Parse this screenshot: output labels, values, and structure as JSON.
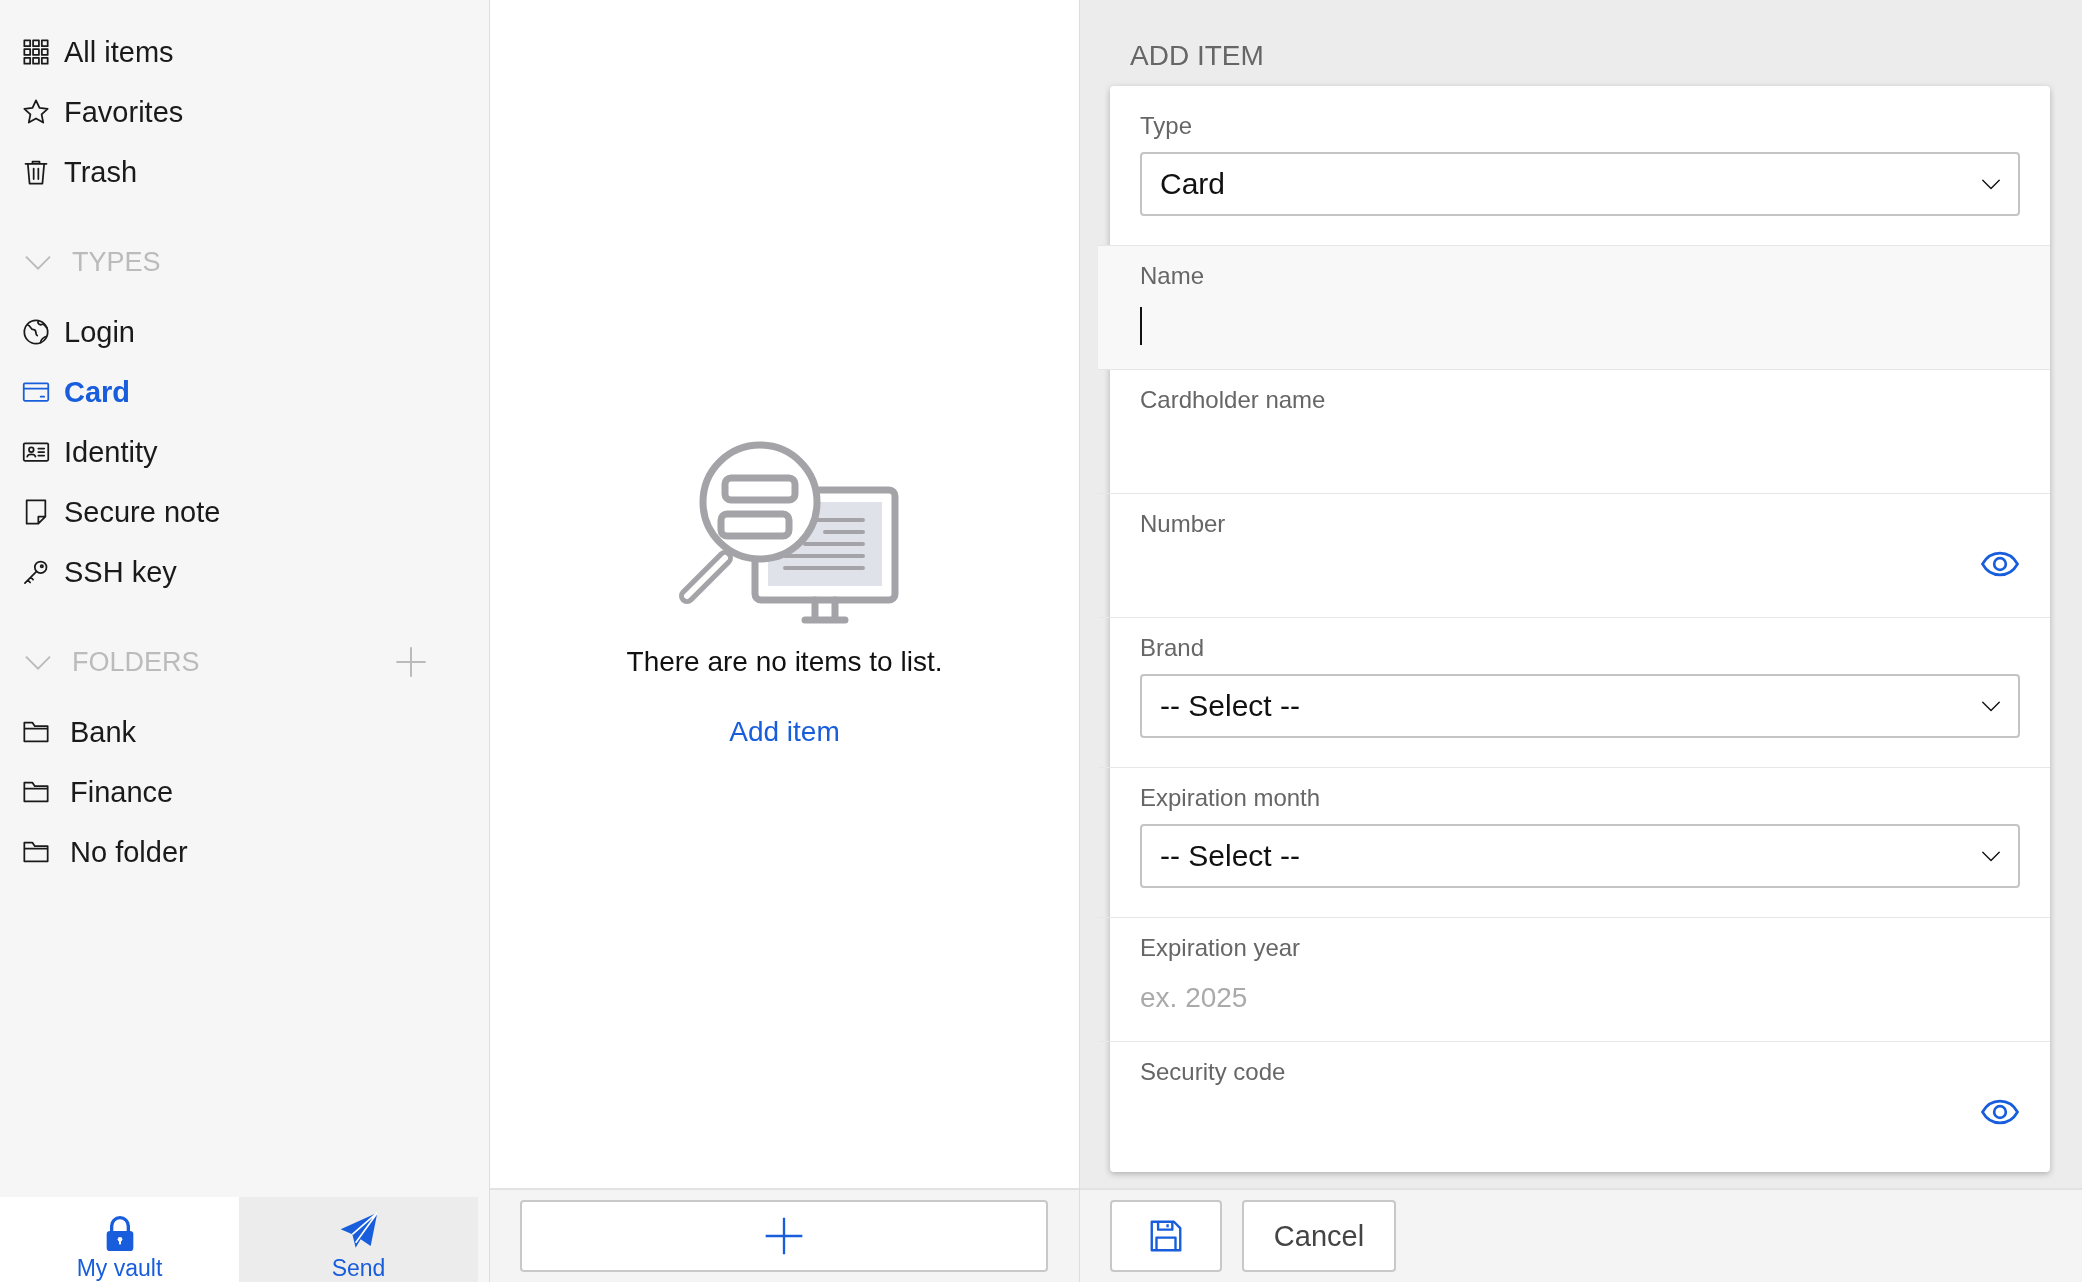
{
  "sidebar": {
    "items": [
      {
        "label": "All items",
        "selected": false
      },
      {
        "label": "Favorites",
        "selected": false
      },
      {
        "label": "Trash",
        "selected": false
      }
    ],
    "types": {
      "title": "TYPES",
      "expanded": true,
      "items": [
        {
          "label": "Login",
          "selected": false
        },
        {
          "label": "Card",
          "selected": true
        },
        {
          "label": "Identity",
          "selected": false
        },
        {
          "label": "Secure note",
          "selected": false
        },
        {
          "label": "SSH key",
          "selected": false
        }
      ]
    },
    "folders": {
      "title": "FOLDERS",
      "expanded": true,
      "items": [
        {
          "label": "Bank",
          "selected": false
        },
        {
          "label": "Finance",
          "selected": false
        },
        {
          "label": "No folder",
          "selected": false
        }
      ]
    }
  },
  "bottom_nav": [
    {
      "label": "My vault",
      "selected": true
    },
    {
      "label": "Send",
      "selected": false
    }
  ],
  "list": {
    "empty_message": "There are no items to list.",
    "add_link": "Add item"
  },
  "form": {
    "title": "ADD ITEM",
    "fields": [
      {
        "kind": "select",
        "label": "Type",
        "value": "Card"
      },
      {
        "kind": "text",
        "label": "Name",
        "focused": true
      },
      {
        "kind": "text",
        "label": "Cardholder name",
        "focused": false
      },
      {
        "kind": "secret",
        "label": "Number"
      },
      {
        "kind": "select",
        "label": "Brand",
        "value": "-- Select --"
      },
      {
        "kind": "select",
        "label": "Expiration month",
        "value": "-- Select --"
      },
      {
        "kind": "text",
        "label": "Expiration year",
        "placeholder": "ex. 2025",
        "focused": false
      },
      {
        "kind": "secret",
        "label": "Security code"
      }
    ],
    "cancel": "Cancel"
  }
}
